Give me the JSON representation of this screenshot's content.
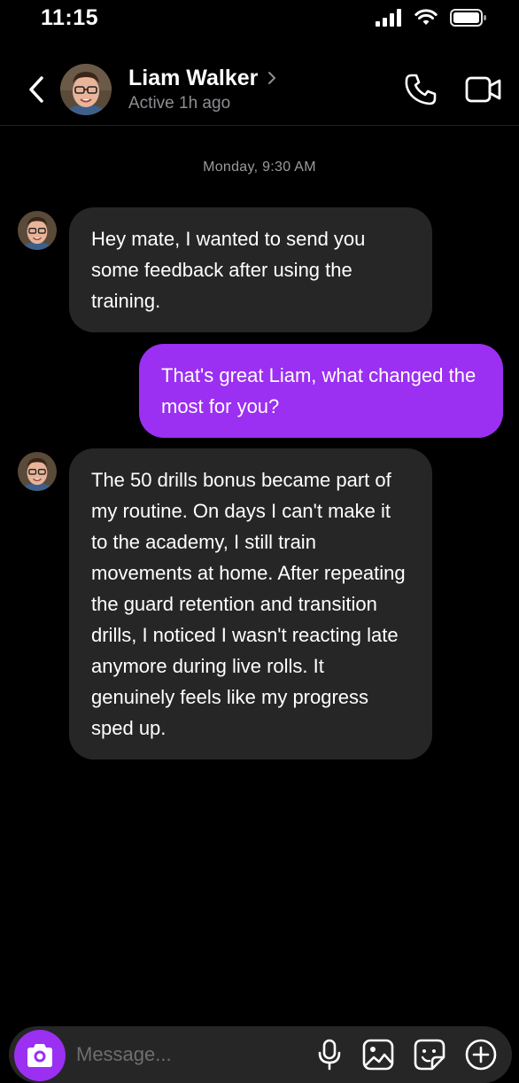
{
  "status_bar": {
    "time": "11:15"
  },
  "header": {
    "contact_name": "Liam Walker",
    "contact_status": "Active 1h ago"
  },
  "conversation": {
    "timestamp": "Monday, 9:30 AM",
    "messages": [
      {
        "direction": "incoming",
        "text": "Hey mate, I wanted to send you some feedback after using the training."
      },
      {
        "direction": "outgoing",
        "text": "That's great Liam, what changed the most for you?"
      },
      {
        "direction": "incoming",
        "text": "The 50 drills bonus became part of my routine. On days I can't make it to the academy, I still train movements at home. After repeating the guard retention and transition drills, I noticed I wasn't reacting late anymore during live rolls. It genuinely feels like my progress sped up."
      }
    ]
  },
  "composer": {
    "placeholder": "Message..."
  },
  "icons": {
    "back": "chevron-left-icon",
    "call": "phone-icon",
    "video": "video-camera-icon",
    "camera": "camera-icon",
    "mic": "microphone-icon",
    "gallery": "image-icon",
    "sticker": "sticker-icon",
    "add": "plus-circle-icon"
  },
  "colors": {
    "accent": "#9b2ff2",
    "incoming_bubble": "#262626",
    "background": "#000000",
    "secondary_text": "#8e8e93"
  }
}
